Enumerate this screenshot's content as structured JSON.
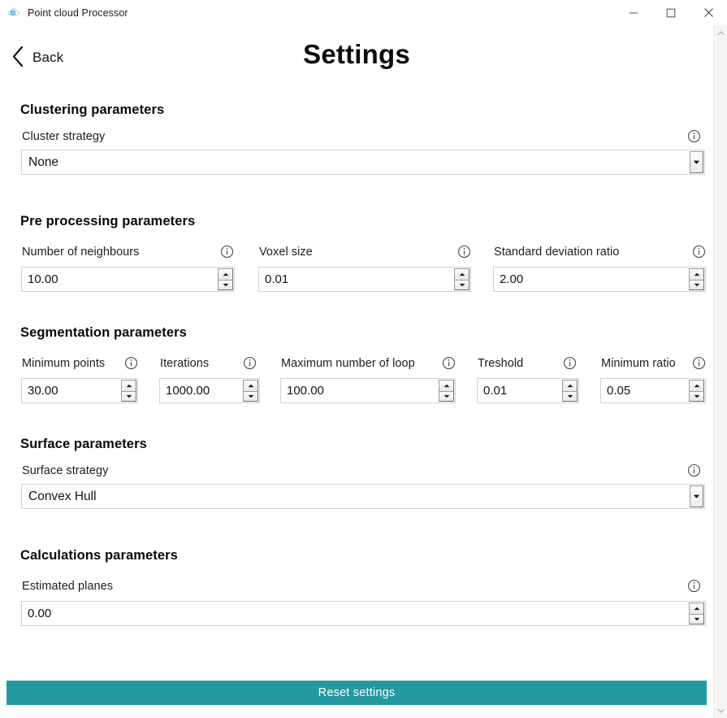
{
  "window": {
    "title": "Point cloud Processor",
    "icon": "cloud-icon",
    "controls": {
      "minimize": "minimize-icon",
      "maximize": "maximize-icon",
      "close": "close-icon"
    }
  },
  "header": {
    "back_label": "Back",
    "back_icon": "chevron-left-icon",
    "title": "Settings"
  },
  "sections": {
    "clustering": {
      "title": "Clustering parameters",
      "cluster_strategy": {
        "label": "Cluster strategy",
        "value": "None",
        "info_icon": "info-icon",
        "arrow_icon": "chevron-down-icon"
      }
    },
    "preprocessing": {
      "title": "Pre processing parameters",
      "fields": [
        {
          "label": "Number of neighbours",
          "value": "10.00",
          "info_icon": "info-icon"
        },
        {
          "label": "Voxel size",
          "value": "0.01",
          "info_icon": "info-icon"
        },
        {
          "label": "Standard deviation ratio",
          "value": "2.00",
          "info_icon": "info-icon"
        }
      ]
    },
    "segmentation": {
      "title": "Segmentation parameters",
      "fields": [
        {
          "label": "Minimum points",
          "value": "30.00",
          "info_icon": "info-icon"
        },
        {
          "label": "Iterations",
          "value": "1000.00",
          "info_icon": "info-icon"
        },
        {
          "label": "Maximum number of loop",
          "value": "100.00",
          "info_icon": "info-icon"
        },
        {
          "label": "Treshold",
          "value": "0.01",
          "info_icon": "info-icon"
        },
        {
          "label": "Minimum ratio",
          "value": "0.05",
          "info_icon": "info-icon"
        }
      ]
    },
    "surface": {
      "title": "Surface parameters",
      "surface_strategy": {
        "label": "Surface strategy",
        "value": "Convex Hull",
        "info_icon": "info-icon",
        "arrow_icon": "chevron-down-icon"
      }
    },
    "calculations": {
      "title": "Calculations parameters",
      "estimated_planes": {
        "label": "Estimated planes",
        "value": "0.00",
        "info_icon": "info-icon"
      }
    }
  },
  "footer": {
    "reset_label": "Reset settings"
  },
  "scrollbar": {
    "up_icon": "chevron-up-icon",
    "down_icon": "chevron-down-icon"
  },
  "colors": {
    "accent": "#2399a1",
    "field_border": "#c9d3e0",
    "text": "#1b1b1b"
  }
}
